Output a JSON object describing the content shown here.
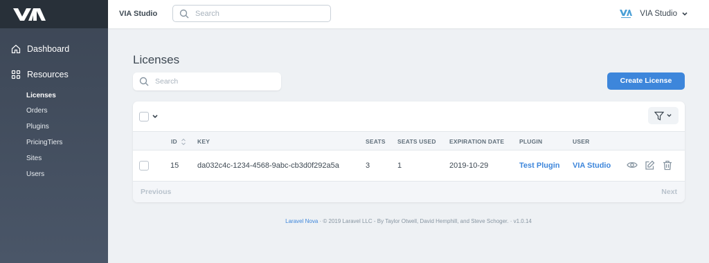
{
  "sidebar": {
    "logo": "VIA",
    "nav": [
      {
        "label": "Dashboard"
      },
      {
        "label": "Resources"
      }
    ],
    "resources": [
      {
        "label": "Licenses",
        "active": true
      },
      {
        "label": "Orders"
      },
      {
        "label": "Plugins"
      },
      {
        "label": "PricingTiers"
      },
      {
        "label": "Sites"
      },
      {
        "label": "Users"
      }
    ]
  },
  "header": {
    "title": "VIA Studio",
    "search_placeholder": "Search",
    "user_name": "VIA Studio"
  },
  "main": {
    "page_title": "Licenses",
    "search_placeholder": "Search",
    "create_button": "Create License",
    "columns": [
      "ID",
      "KEY",
      "SEATS",
      "SEATS USED",
      "EXPIRATION DATE",
      "PLUGIN",
      "USER"
    ],
    "rows": [
      {
        "id": "15",
        "key": "da032c4c-1234-4568-9abc-cb3d0f292a5a",
        "seats": "3",
        "seats_used": "1",
        "expiration_date": "2019-10-29",
        "plugin": "Test Plugin",
        "user": "VIA Studio"
      }
    ],
    "pagination": {
      "previous": "Previous",
      "next": "Next"
    }
  },
  "footer": {
    "link": "Laravel Nova",
    "text": "· © 2019 Laravel LLC - By Taylor Otwell, David Hemphill, and Steve Schoger. · v1.0.14"
  },
  "colors": {
    "accent": "#3d86db",
    "sidebar": "#3c4655",
    "sidebar_top": "#283039"
  },
  "icons": [
    "via-logo-icon",
    "search-icon",
    "home-icon",
    "grid-icon",
    "chevron-down-icon",
    "filter-icon",
    "sort-icon",
    "eye-icon",
    "edit-icon",
    "trash-icon"
  ]
}
